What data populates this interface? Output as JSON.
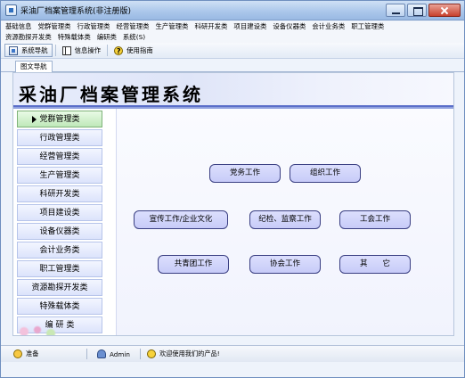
{
  "window": {
    "title": "采油厂档案管理系统(非注册版)"
  },
  "menus": {
    "row1": [
      "基础信息",
      "党群管理类",
      "行政管理类",
      "经营管理类",
      "生产管理类",
      "科研开发类",
      "项目建设类",
      "设备仪器类",
      "会计业务类",
      "职工管理类"
    ],
    "row2": [
      "资源勘探开发类",
      "特殊载体类",
      "编研类",
      "系统(S)"
    ]
  },
  "toolbar": {
    "nav_label": "系统导航",
    "info_label": "信息操作",
    "help_label": "使用指南"
  },
  "tabs": {
    "active": "图文导航"
  },
  "banner": {
    "title": "采油厂档案管理系统"
  },
  "sidebar": {
    "items": [
      "党群管理类",
      "行政管理类",
      "经营管理类",
      "生产管理类",
      "科研开发类",
      "项目建设类",
      "设备仪器类",
      "会计业务类",
      "职工管理类",
      "资源勘探开发类",
      "特殊载体类",
      "编 研 类"
    ],
    "active_index": 0
  },
  "panel": {
    "buttons": [
      "党务工作",
      "组织工作",
      "宣传工作/企业文化",
      "纪检、监察工作",
      "工会工作",
      "共青团工作",
      "协会工作",
      "其　　它"
    ]
  },
  "status": {
    "ready": "准备",
    "user": "Admin",
    "message": "欢迎使用我们的产品!"
  },
  "colors": {
    "accent": "#5a6ec9",
    "active_item": "#bfe8b9",
    "button_fill": "#c7cbf8"
  }
}
